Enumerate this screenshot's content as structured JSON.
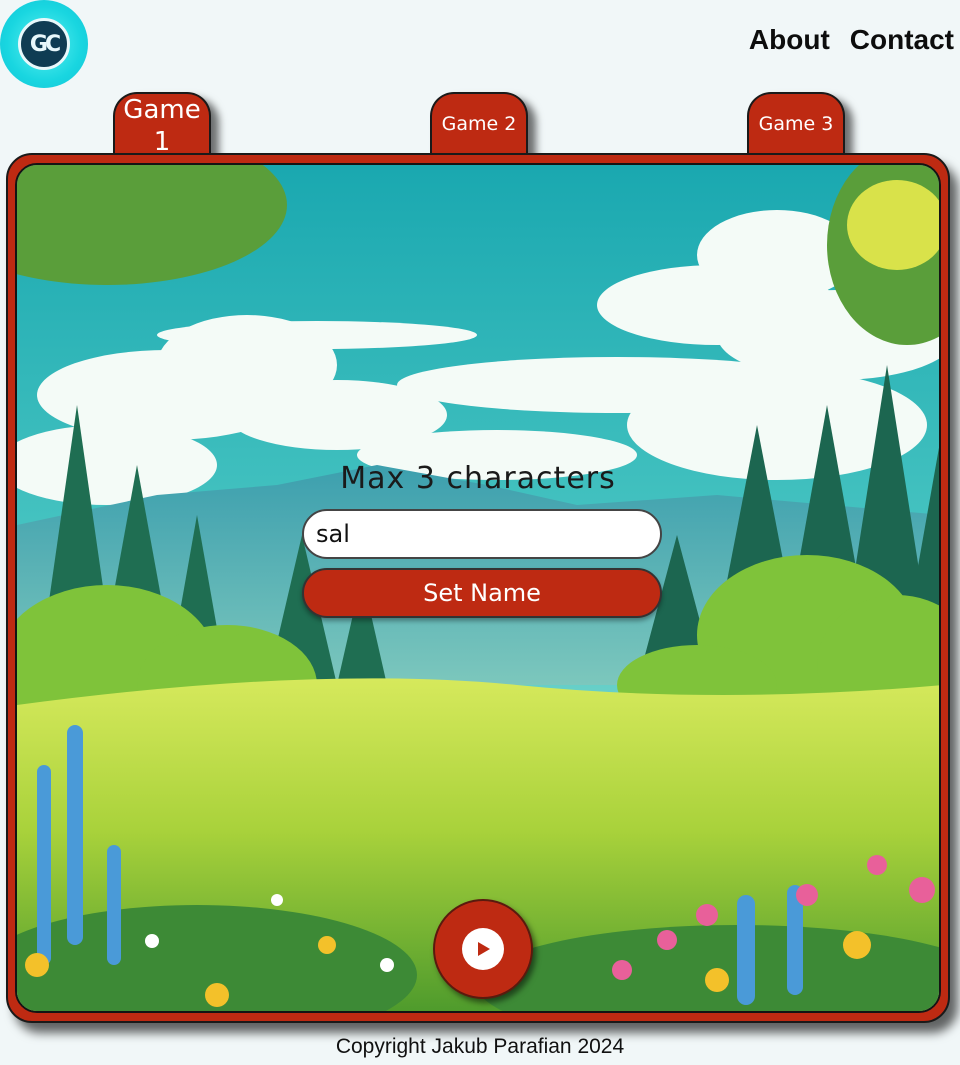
{
  "header": {
    "logo_text": "GC",
    "nav": [
      {
        "label": "About"
      },
      {
        "label": "Contact"
      }
    ]
  },
  "tabs": [
    {
      "label": "Game 1"
    },
    {
      "label": "Game 2"
    },
    {
      "label": "Game 3"
    }
  ],
  "form": {
    "title": "Max 3 characters",
    "name_value": "sal",
    "set_button": "Set Name"
  },
  "play": {
    "icon": "play-icon"
  },
  "footer": {
    "copyright": "Copyright Jakub Parafian 2024"
  },
  "colors": {
    "accent": "#be2a12",
    "logo": "#19d6e0",
    "background": "#f1f7f8"
  }
}
